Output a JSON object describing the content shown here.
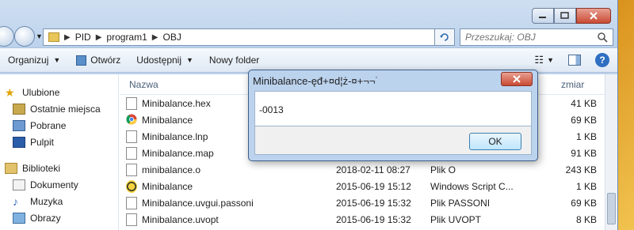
{
  "address": {
    "crumbs": [
      "PID",
      "program1",
      "OBJ"
    ],
    "search_placeholder": "Przeszukaj: OBJ"
  },
  "toolbar": {
    "organize": "Organizuj",
    "open": "Otwórz",
    "share": "Udostępnij",
    "new_folder": "Nowy folder"
  },
  "nav": {
    "favorites": "Ulubione",
    "recent": "Ostatnie miejsca",
    "downloads": "Pobrane",
    "desktop": "Pulpit",
    "libraries": "Biblioteki",
    "documents": "Dokumenty",
    "music": "Muzyka",
    "pictures": "Obrazy"
  },
  "columns": {
    "name": "Nazwa",
    "size": "zmiar"
  },
  "files": [
    {
      "name": "Minibalance.hex",
      "date": "",
      "type": "",
      "size": "41 KB",
      "icon": "file-icon"
    },
    {
      "name": "Minibalance",
      "date": "",
      "type": "",
      "size": "69 KB",
      "icon": "chrome-icon"
    },
    {
      "name": "Minibalance.lnp",
      "date": "",
      "type": "",
      "size": "1 KB",
      "icon": "file-icon"
    },
    {
      "name": "Minibalance.map",
      "date": "",
      "type": "",
      "size": "91 KB",
      "icon": "file-icon"
    },
    {
      "name": "minibalance.o",
      "date": "2018-02-11 08:27",
      "type": "Plik O",
      "size": "243 KB",
      "icon": "file-icon"
    },
    {
      "name": "Minibalance",
      "date": "2015-06-19 15:12",
      "type": "Windows Script C...",
      "size": "1 KB",
      "icon": "script-icon"
    },
    {
      "name": "Minibalance.uvgui.passoni",
      "date": "2015-06-19 15:32",
      "type": "Plik PASSONI",
      "size": "69 KB",
      "icon": "file-icon"
    },
    {
      "name": "Minibalance.uvopt",
      "date": "2015-06-19 15:32",
      "type": "Plik UVOPT",
      "size": "8 KB",
      "icon": "file-icon"
    }
  ],
  "dialog": {
    "title": "Minibalance-ęđ+¤d¦ż-¤+¬¬˙",
    "message": "-0013",
    "ok": "OK"
  }
}
